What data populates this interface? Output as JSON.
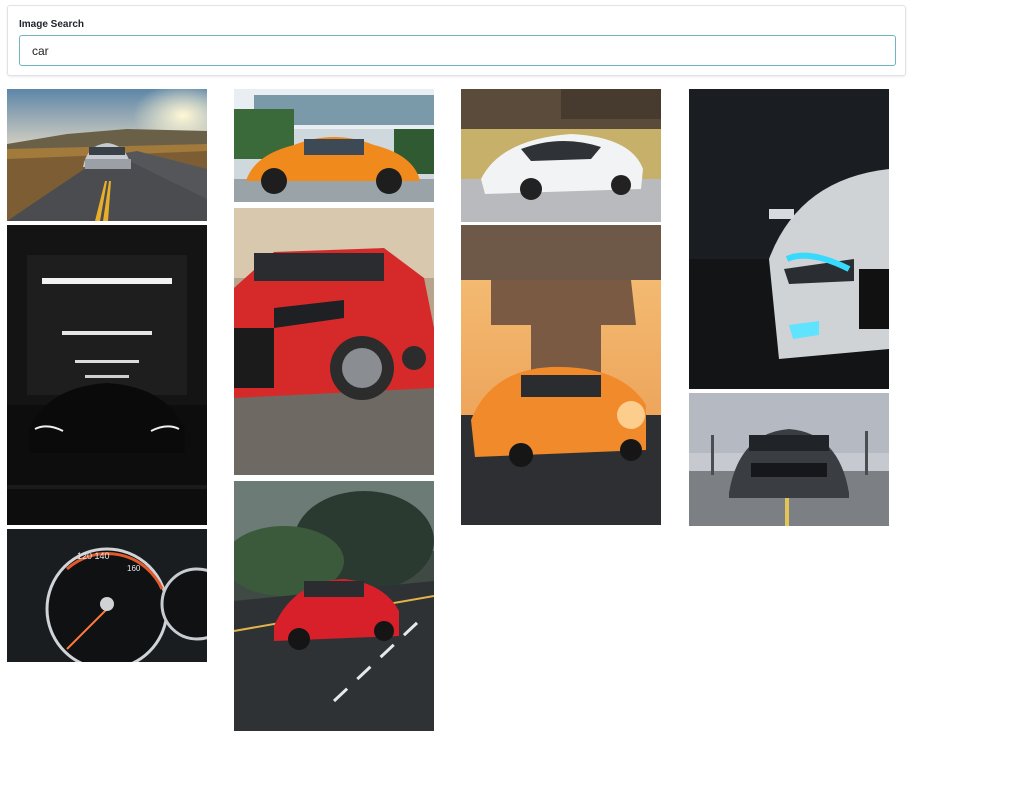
{
  "search": {
    "label": "Image Search",
    "value": "car",
    "placeholder": ""
  },
  "results": [
    {
      "subject": "silver sports car on winding road at sunset"
    },
    {
      "subject": "orange Volkswagen Beetle"
    },
    {
      "subject": "white McLaren supercar"
    },
    {
      "subject": "white Audi with blue headlights in dark"
    },
    {
      "subject": "dark Audi in garage with ceiling lights"
    },
    {
      "subject": "red Hyundai hatchback front"
    },
    {
      "subject": "orange Audi under bridge at sunset"
    },
    {
      "subject": "dark grey Ford Mustang front"
    },
    {
      "subject": "speedometer gauge close-up"
    },
    {
      "subject": "red Audi TT on road through forest"
    }
  ],
  "colors": {
    "input_border": "#6fb5c0",
    "card_border": "#e0e3e6"
  }
}
